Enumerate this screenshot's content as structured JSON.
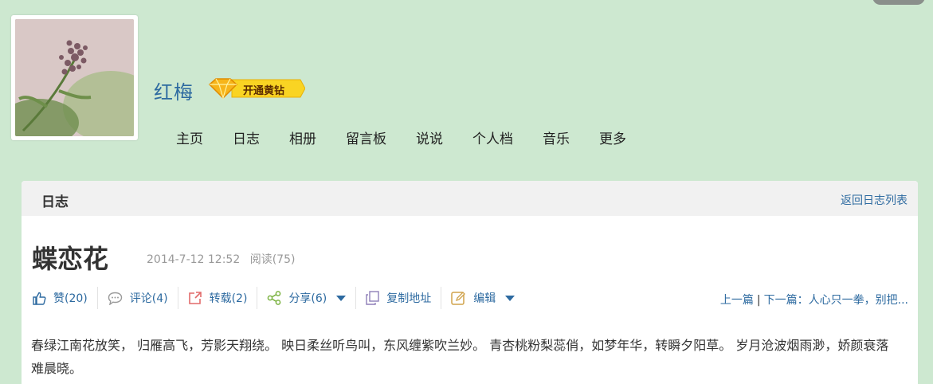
{
  "user": {
    "name": "红梅",
    "vip_label": "开通黄钻"
  },
  "nav": {
    "items": [
      "主页",
      "日志",
      "相册",
      "留言板",
      "说说",
      "个人档",
      "音乐",
      "更多"
    ]
  },
  "section": {
    "title": "日志",
    "back_link": "返回日志列表"
  },
  "post": {
    "title": "蝶恋花",
    "date": "2014-7-12 12:52",
    "reads": "阅读(75)",
    "body": "春绿江南花放笑， 归雁高飞，芳影天翔绕。 映日柔丝听鸟叫，东风缠紫吹兰妙。 青杏桃粉梨蕊俏，如梦年华，转瞬夕阳草。 岁月沧波烟雨渺，娇颜衰落难晨晓。"
  },
  "actions": {
    "like": "赞(20)",
    "comment": "评论(4)",
    "repost": "转载(2)",
    "share": "分享(6)",
    "copy": "复制地址",
    "edit": "编辑"
  },
  "pager": {
    "prev": "上一篇",
    "separator": "|",
    "next": "下一篇：人心只一拳，别把..."
  },
  "colors": {
    "page_bg": "#cde8d0",
    "link": "#2d6aa0",
    "vip_gold": "#f7c21a"
  }
}
